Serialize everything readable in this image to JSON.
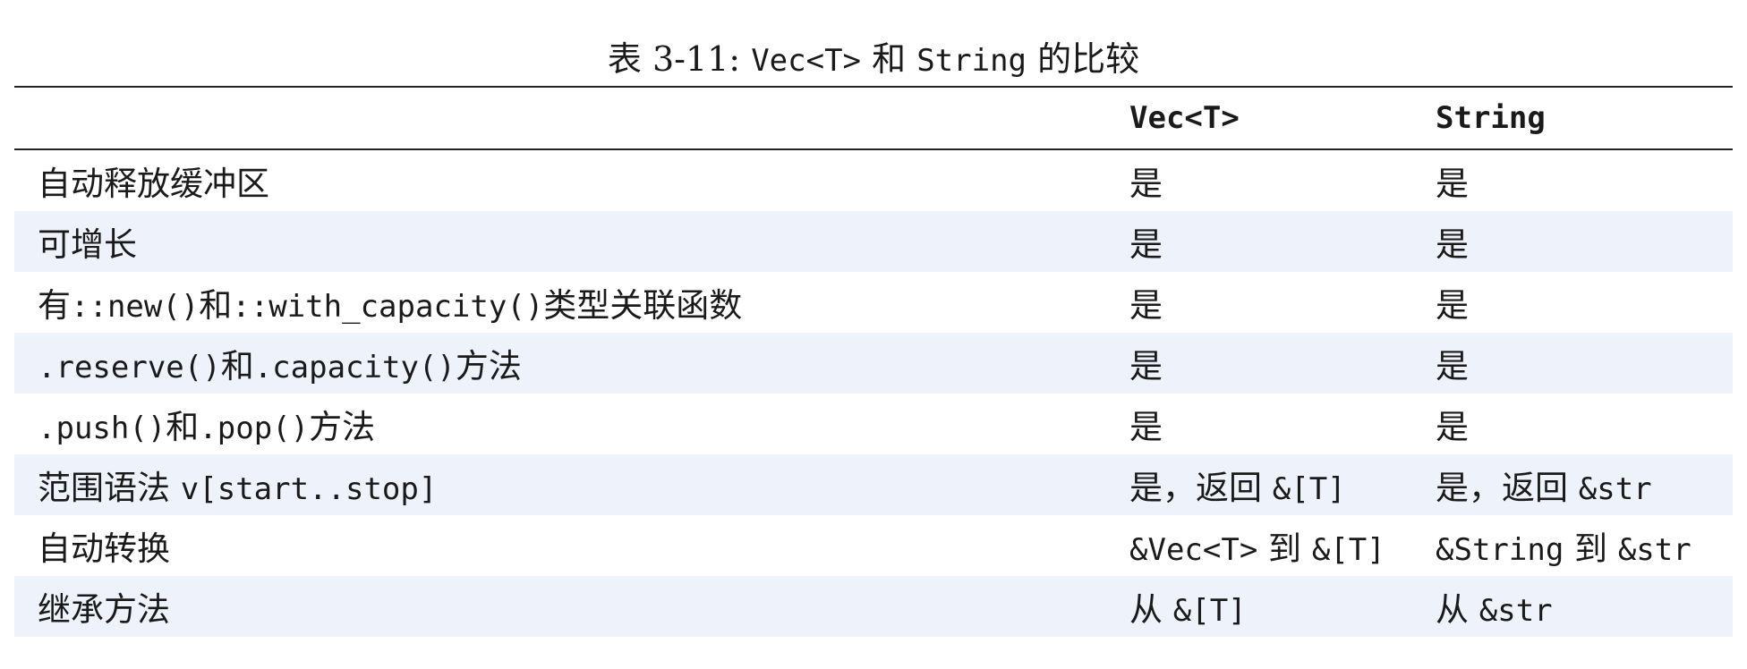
{
  "caption": {
    "prefix": "表 3-11: ",
    "code1": "Vec<T>",
    "mid": " 和 ",
    "code2": "String",
    "suffix": " 的比较"
  },
  "header": {
    "col1": "",
    "col2": "Vec<T>",
    "col3": "String"
  },
  "rows": [
    {
      "feature": "自动释放缓冲区",
      "vec": "是",
      "string": "是"
    },
    {
      "feature": "可增长",
      "vec": "是",
      "string": "是"
    },
    {
      "feature": "有::new()和::with_capacity()类型关联函数",
      "vec": "是",
      "string": "是"
    },
    {
      "feature": ".reserve()和.capacity()方法",
      "vec": "是",
      "string": "是"
    },
    {
      "feature": ".push()和.pop()方法",
      "vec": "是",
      "string": "是"
    },
    {
      "feature": "范围语法 v[start..stop]",
      "vec": "是，返回 &[T]",
      "string": "是，返回 &str"
    },
    {
      "feature": "自动转换",
      "vec": "&Vec<T> 到 &[T]",
      "string": "&String 到 &str"
    },
    {
      "feature": "继承方法",
      "vec": "从 &[T]",
      "string": "从 &str"
    }
  ]
}
